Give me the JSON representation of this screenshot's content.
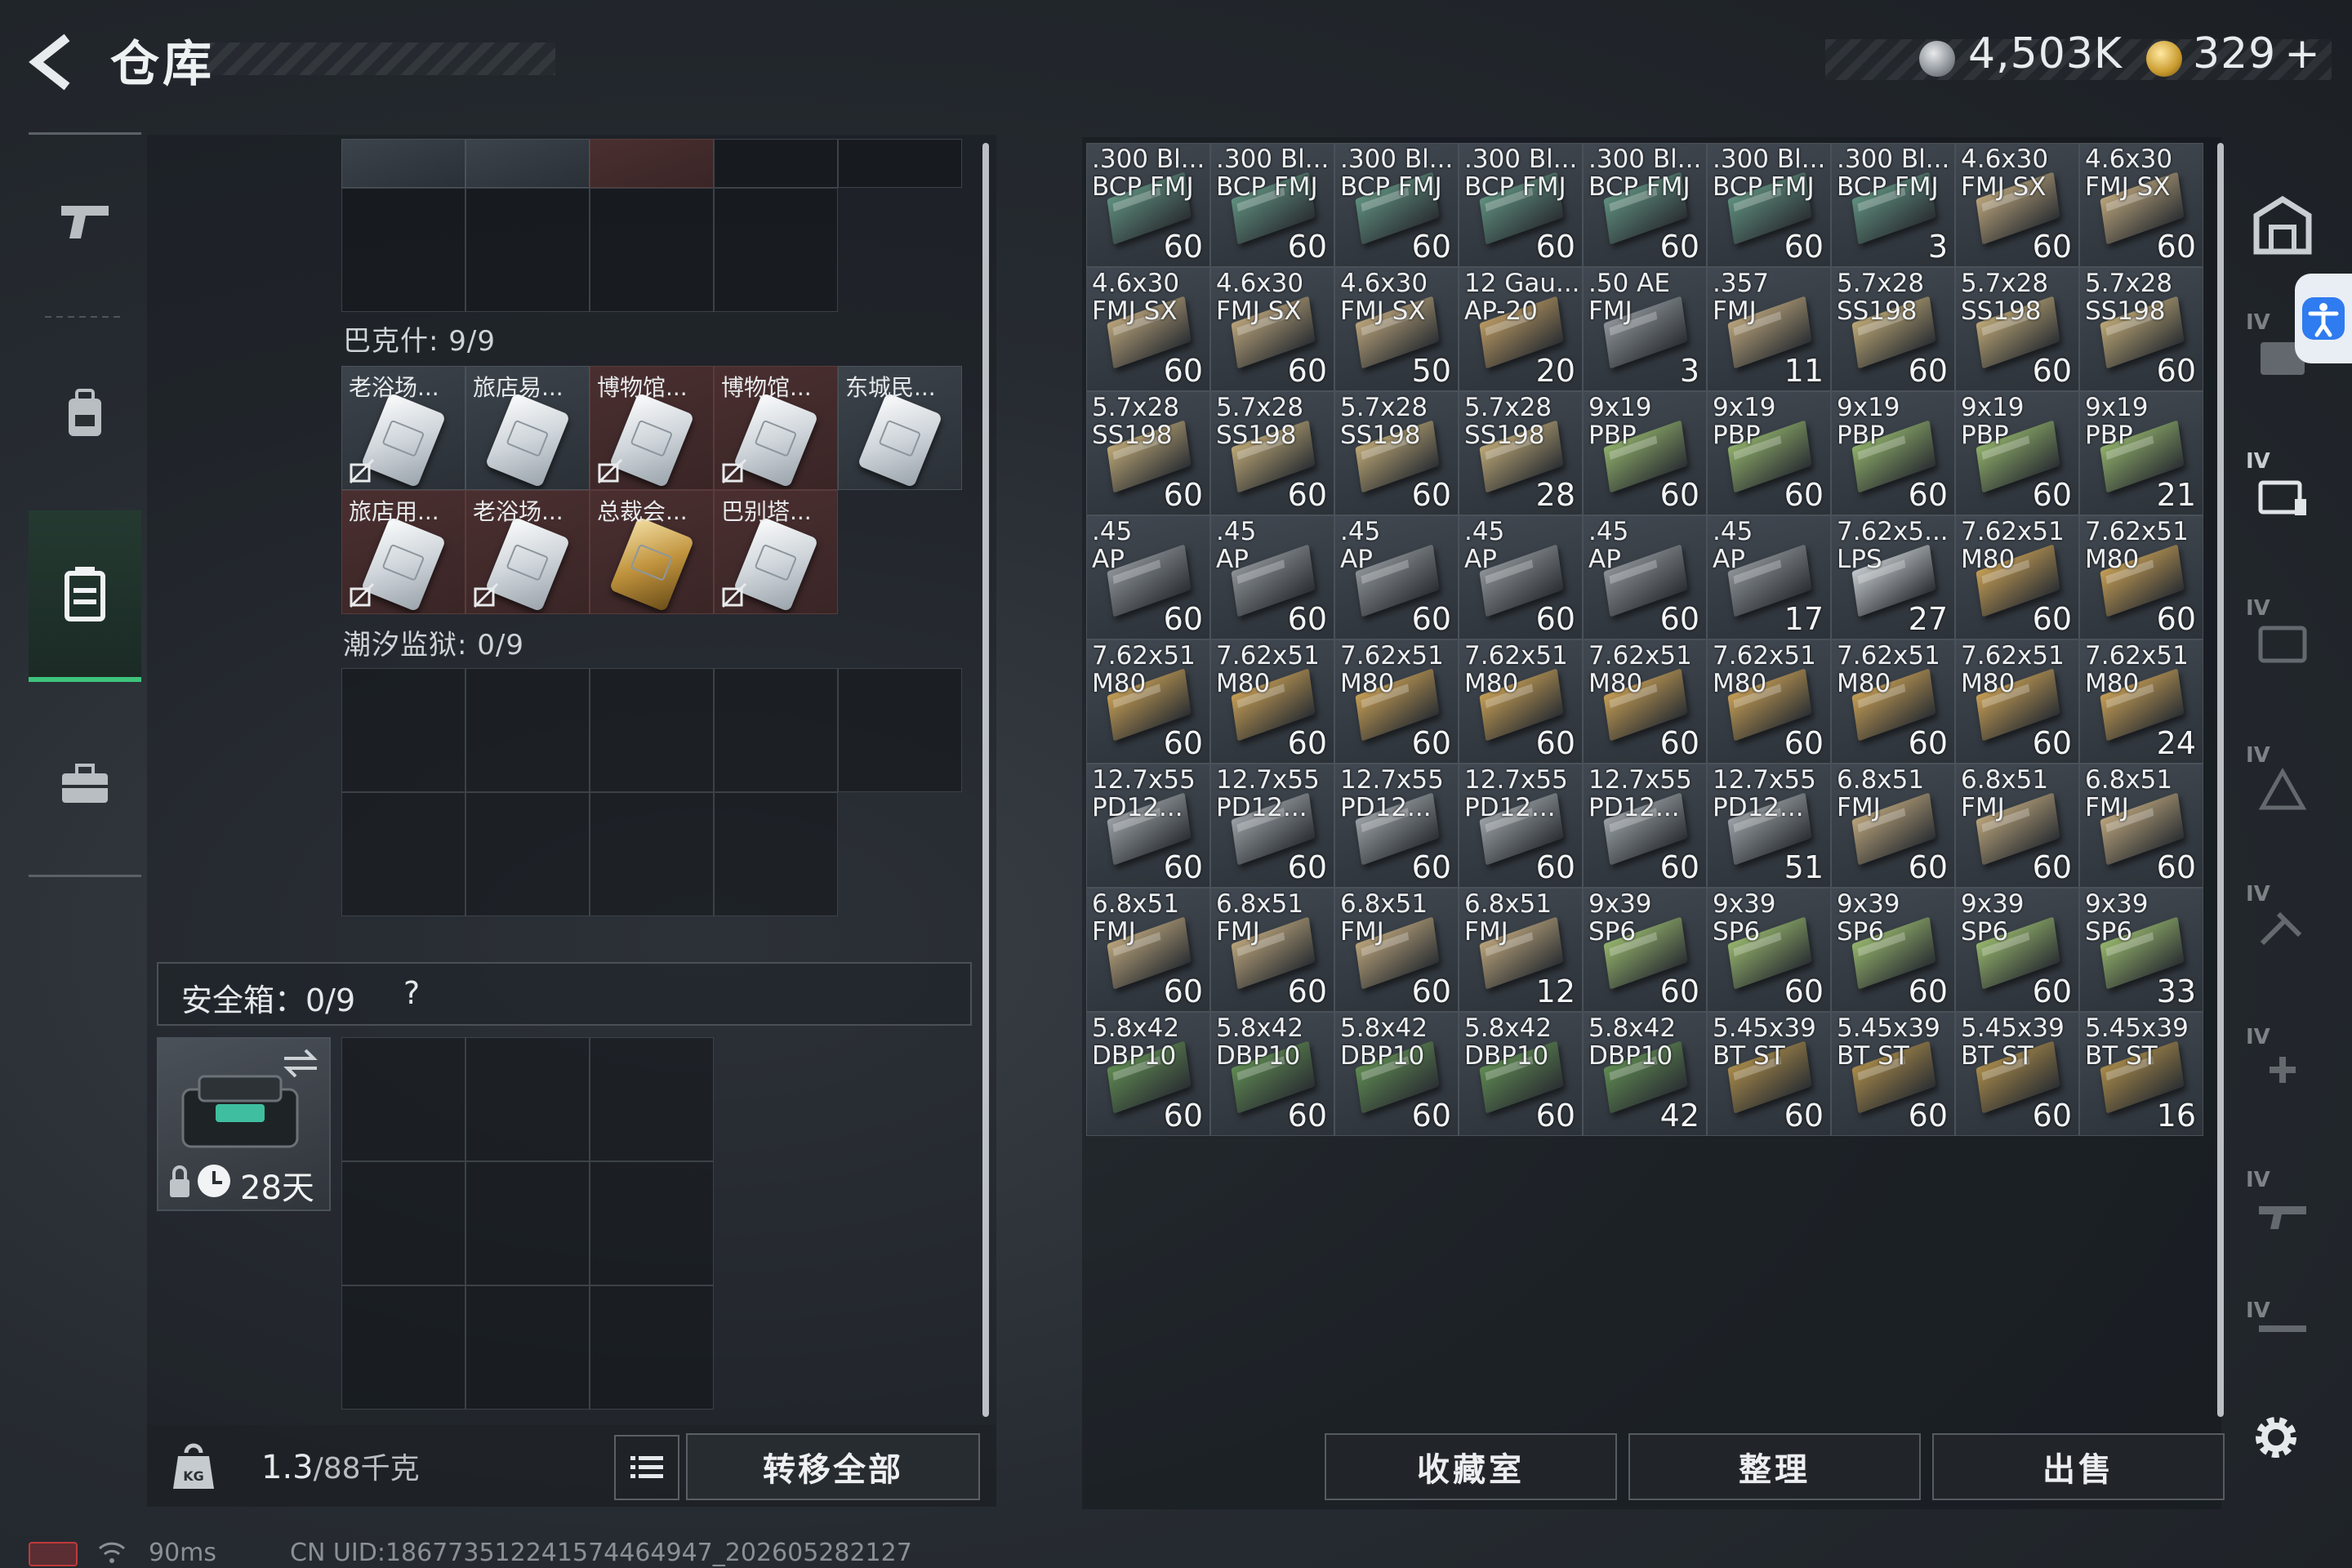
{
  "header": {
    "title": "仓库",
    "silver": "4,503K",
    "gold": "329",
    "gold_plus": "+"
  },
  "left": {
    "sections": [
      {
        "label": "巴克什: 9/9",
        "items": [
          {
            "name": "老浴场...",
            "bg": "filled",
            "card": "silver",
            "noexport": true
          },
          {
            "name": "旅店易...",
            "bg": "filled",
            "card": "silver",
            "noexport": false
          },
          {
            "name": "博物馆...",
            "bg": "red",
            "card": "silver",
            "noexport": true
          },
          {
            "name": "博物馆...",
            "bg": "red",
            "card": "silver",
            "noexport": true
          },
          {
            "name": "东城民...",
            "bg": "filled",
            "card": "silver",
            "noexport": false
          },
          {
            "name": "旅店用...",
            "bg": "red",
            "card": "silver",
            "noexport": true
          },
          {
            "name": "老浴场...",
            "bg": "red",
            "card": "silver",
            "noexport": true
          },
          {
            "name": "总裁会...",
            "bg": "red",
            "card": "gold",
            "noexport": false
          },
          {
            "name": "巴别塔...",
            "bg": "red",
            "card": "silver",
            "noexport": true
          }
        ]
      },
      {
        "label": "潮汐监狱: 0/9"
      }
    ],
    "safe": {
      "label": "安全箱：0/9",
      "help": "?",
      "days": "28天"
    },
    "weight": {
      "value": "1.3",
      "capacity": "/88千克"
    },
    "transfer_label": "转移全部"
  },
  "stash": [
    {
      "name": ".300 Bl...\nBCP FMJ",
      "count": "60",
      "color": "#5f8f7e"
    },
    {
      "name": ".300 Bl...\nBCP FMJ",
      "count": "60",
      "color": "#5f8f7e"
    },
    {
      "name": ".300 Bl...\nBCP FMJ",
      "count": "60",
      "color": "#5f8f7e"
    },
    {
      "name": ".300 Bl...\nBCP FMJ",
      "count": "60",
      "color": "#5f8f7e"
    },
    {
      "name": ".300 Bl...\nBCP FMJ",
      "count": "60",
      "color": "#5f8f7e"
    },
    {
      "name": ".300 Bl...\nBCP FMJ",
      "count": "60",
      "color": "#5f8f7e"
    },
    {
      "name": ".300 Bl...\nBCP FMJ",
      "count": "3",
      "color": "#5f8f7e"
    },
    {
      "name": "4.6x30\nFMJ SX",
      "count": "60",
      "color": "#b8a27a"
    },
    {
      "name": "4.6x30\nFMJ SX",
      "count": "60",
      "color": "#b8a27a"
    },
    {
      "name": "4.6x30\nFMJ SX",
      "count": "60",
      "color": "#b8a27a"
    },
    {
      "name": "4.6x30\nFMJ SX",
      "count": "60",
      "color": "#b8a27a"
    },
    {
      "name": "4.6x30\nFMJ SX",
      "count": "50",
      "color": "#b8a27a"
    },
    {
      "name": "12 Gau...\nAP-20",
      "count": "20",
      "color": "#b99862"
    },
    {
      "name": ".50 AE\nFMJ",
      "count": "3",
      "color": "#8d9398"
    },
    {
      "name": ".357\nFMJ",
      "count": "11",
      "color": "#b8a27a"
    },
    {
      "name": "5.7x28\nSS198",
      "count": "60",
      "color": "#bca776"
    },
    {
      "name": "5.7x28\nSS198",
      "count": "60",
      "color": "#bca776"
    },
    {
      "name": "5.7x28\nSS198",
      "count": "60",
      "color": "#bca776"
    },
    {
      "name": "5.7x28\nSS198",
      "count": "60",
      "color": "#bca776"
    },
    {
      "name": "5.7x28\nSS198",
      "count": "60",
      "color": "#bca776"
    },
    {
      "name": "5.7x28\nSS198",
      "count": "60",
      "color": "#bca776"
    },
    {
      "name": "5.7x28\nSS198",
      "count": "28",
      "color": "#bca776"
    },
    {
      "name": "9x19\nPBP",
      "count": "60",
      "color": "#8fae6a"
    },
    {
      "name": "9x19\nPBP",
      "count": "60",
      "color": "#8fae6a"
    },
    {
      "name": "9x19\nPBP",
      "count": "60",
      "color": "#8fae6a"
    },
    {
      "name": "9x19\nPBP",
      "count": "60",
      "color": "#8fae6a"
    },
    {
      "name": "9x19\nPBP",
      "count": "21",
      "color": "#8fae6a"
    },
    {
      "name": ".45\nAP",
      "count": "60",
      "color": "#8c9196"
    },
    {
      "name": ".45\nAP",
      "count": "60",
      "color": "#8c9196"
    },
    {
      "name": ".45\nAP",
      "count": "60",
      "color": "#8c9196"
    },
    {
      "name": ".45\nAP",
      "count": "60",
      "color": "#8c9196"
    },
    {
      "name": ".45\nAP",
      "count": "60",
      "color": "#8c9196"
    },
    {
      "name": ".45\nAP",
      "count": "17",
      "color": "#8c9196"
    },
    {
      "name": "7.62x5...\nLPS",
      "count": "27",
      "color": "#c3c8cc"
    },
    {
      "name": "7.62x51\nM80",
      "count": "60",
      "color": "#c49d55"
    },
    {
      "name": "7.62x51\nM80",
      "count": "60",
      "color": "#c49d55"
    },
    {
      "name": "7.62x51\nM80",
      "count": "60",
      "color": "#c49d55"
    },
    {
      "name": "7.62x51\nM80",
      "count": "60",
      "color": "#c49d55"
    },
    {
      "name": "7.62x51\nM80",
      "count": "60",
      "color": "#c49d55"
    },
    {
      "name": "7.62x51\nM80",
      "count": "60",
      "color": "#c49d55"
    },
    {
      "name": "7.62x51\nM80",
      "count": "60",
      "color": "#c49d55"
    },
    {
      "name": "7.62x51\nM80",
      "count": "60",
      "color": "#c49d55"
    },
    {
      "name": "7.62x51\nM80",
      "count": "60",
      "color": "#c49d55"
    },
    {
      "name": "7.62x51\nM80",
      "count": "60",
      "color": "#c49d55"
    },
    {
      "name": "7.62x51\nM80",
      "count": "24",
      "color": "#c49d55"
    },
    {
      "name": "12.7x55\nPD12...",
      "count": "60",
      "color": "#9aa0a5"
    },
    {
      "name": "12.7x55\nPD12...",
      "count": "60",
      "color": "#9aa0a5"
    },
    {
      "name": "12.7x55\nPD12...",
      "count": "60",
      "color": "#9aa0a5"
    },
    {
      "name": "12.7x55\nPD12...",
      "count": "60",
      "color": "#9aa0a5"
    },
    {
      "name": "12.7x55\nPD12...",
      "count": "60",
      "color": "#9aa0a5"
    },
    {
      "name": "12.7x55\nPD12...",
      "count": "51",
      "color": "#9aa0a5"
    },
    {
      "name": "6.8x51\nFMJ",
      "count": "60",
      "color": "#b8a27a"
    },
    {
      "name": "6.8x51\nFMJ",
      "count": "60",
      "color": "#b8a27a"
    },
    {
      "name": "6.8x51\nFMJ",
      "count": "60",
      "color": "#b8a27a"
    },
    {
      "name": "6.8x51\nFMJ",
      "count": "60",
      "color": "#b8a27a"
    },
    {
      "name": "6.8x51\nFMJ",
      "count": "60",
      "color": "#b8a27a"
    },
    {
      "name": "6.8x51\nFMJ",
      "count": "60",
      "color": "#b8a27a"
    },
    {
      "name": "6.8x51\nFMJ",
      "count": "12",
      "color": "#b8a27a"
    },
    {
      "name": "9x39\nSP6",
      "count": "60",
      "color": "#95b46c"
    },
    {
      "name": "9x39\nSP6",
      "count": "60",
      "color": "#95b46c"
    },
    {
      "name": "9x39\nSP6",
      "count": "60",
      "color": "#95b46c"
    },
    {
      "name": "9x39\nSP6",
      "count": "60",
      "color": "#95b46c"
    },
    {
      "name": "9x39\nSP6",
      "count": "33",
      "color": "#95b46c"
    },
    {
      "name": "5.8x42\nDBP10",
      "count": "60",
      "color": "#5f8a52"
    },
    {
      "name": "5.8x42\nDBP10",
      "count": "60",
      "color": "#5f8a52"
    },
    {
      "name": "5.8x42\nDBP10",
      "count": "60",
      "color": "#5f8a52"
    },
    {
      "name": "5.8x42\nDBP10",
      "count": "60",
      "color": "#5f8a52"
    },
    {
      "name": "5.8x42\nDBP10",
      "count": "42",
      "color": "#5f8a52"
    },
    {
      "name": "5.45x39\nBT ST",
      "count": "60",
      "color": "#a88a4a"
    },
    {
      "name": "5.45x39\nBT ST",
      "count": "60",
      "color": "#a88a4a"
    },
    {
      "name": "5.45x39\nBT ST",
      "count": "60",
      "color": "#a88a4a"
    },
    {
      "name": "5.45x39\nBT ST",
      "count": "16",
      "color": "#a88a4a"
    }
  ],
  "right_nav": {
    "tiers": [
      "IV",
      "IV",
      "IV",
      "IV",
      "IV",
      "IV",
      "IV",
      "IV"
    ]
  },
  "actions": {
    "collection": "收藏室",
    "sort": "整理",
    "sell": "出售"
  },
  "status": {
    "ping": "90ms",
    "uid": "CN UID:18677351224157446494​7_202605282127"
  },
  "colors": {
    "accent": "#3ec47c",
    "red_cell": "#4a2f30",
    "panel": "#2b3137"
  }
}
